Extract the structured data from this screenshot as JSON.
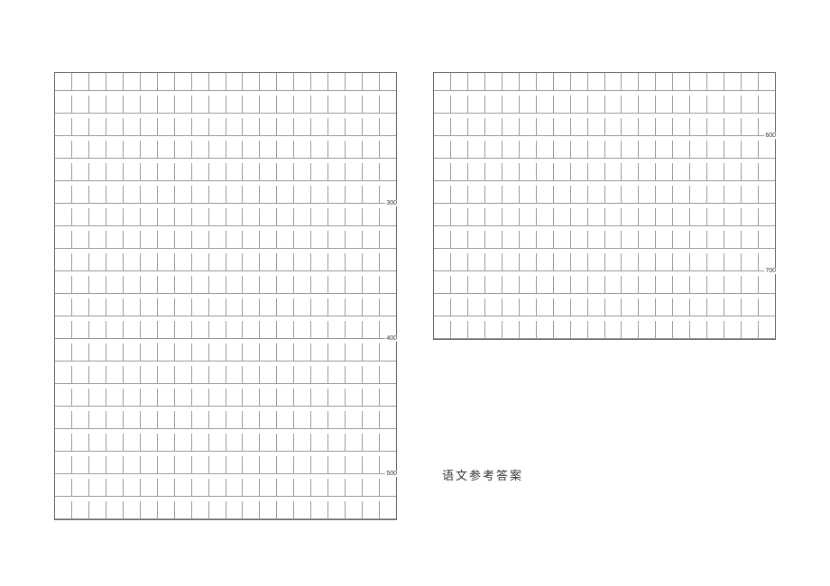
{
  "grid": {
    "columns_per_row": 20,
    "left_column": {
      "rows": 20,
      "labels": [
        {
          "row_index": 6,
          "text": "300"
        },
        {
          "row_index": 12,
          "text": "400"
        },
        {
          "row_index": 18,
          "text": "500"
        }
      ]
    },
    "right_column": {
      "rows": 12,
      "labels": [
        {
          "row_index": 3,
          "text": "600"
        },
        {
          "row_index": 9,
          "text": "700"
        }
      ]
    }
  },
  "footer": {
    "answer_key_title": "语文参考答案"
  }
}
